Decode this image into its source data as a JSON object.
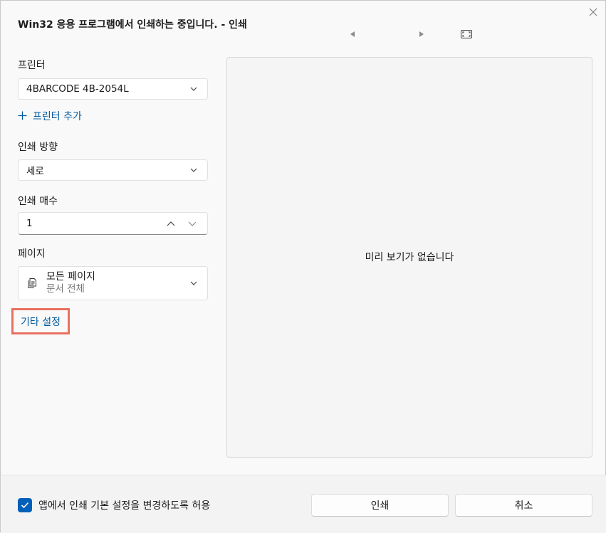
{
  "window": {
    "title": "Win32 응용 프로그램에서 인쇄하는 중입니다. - 인쇄"
  },
  "printer": {
    "label": "프린터",
    "selected": "4BARCODE 4B-2054L",
    "add_label": "프린터 추가"
  },
  "orientation": {
    "label": "인쇄 방향",
    "selected": "세로"
  },
  "copies": {
    "label": "인쇄 매수",
    "value": "1"
  },
  "pages": {
    "label": "페이지",
    "selected": "모든 페이지",
    "description": "문서 전체"
  },
  "more_settings": {
    "label": "기타 설정"
  },
  "preview": {
    "message": "미리 보기가 없습니다"
  },
  "footer": {
    "allow_change_label": "앱에서 인쇄 기본 설정을 변경하도록 허용",
    "print_button": "인쇄",
    "cancel_button": "취소"
  },
  "icons": {
    "close": "close-icon",
    "prev_page": "triangle-left-icon",
    "next_page": "triangle-right-icon",
    "fit": "fit-page-icon",
    "chevron": "chevron-down-icon",
    "chevron_up": "chevron-up-icon",
    "plus": "plus-icon",
    "pages": "pages-icon",
    "checkmark": "checkmark-icon"
  },
  "colors": {
    "accent": "#005fb8",
    "link": "#005a9e",
    "highlight_border": "#e8705e"
  }
}
